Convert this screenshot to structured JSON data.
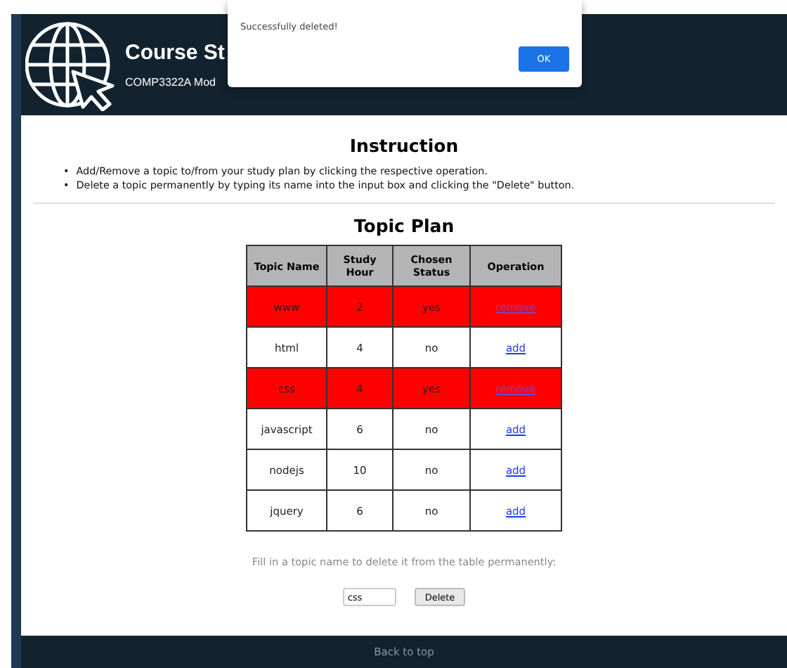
{
  "header": {
    "title": "Course St",
    "subtitle": "COMP3322A Mod"
  },
  "dialog": {
    "message": "Successfully deleted!",
    "button": "OK"
  },
  "instruction": {
    "heading": "Instruction",
    "items": [
      {
        "marker": "•",
        "text": "Add/Remove a topic to/from your study plan by clicking the respective operation."
      },
      {
        "marker": "•",
        "text": "Delete a topic permanently by typing its name into the input box and clicking the \"Delete\" button."
      }
    ]
  },
  "topic_plan": {
    "heading": "Topic Plan",
    "columns": [
      "Topic Name",
      "Study Hour",
      "Chosen Status",
      "Operation"
    ],
    "rows": [
      {
        "name": "www",
        "hours": "2",
        "status": "yes",
        "operation": "remove",
        "chosen": true
      },
      {
        "name": "html",
        "hours": "4",
        "status": "no",
        "operation": "add",
        "chosen": false
      },
      {
        "name": "css",
        "hours": "4",
        "status": "yes",
        "operation": "remove",
        "chosen": true
      },
      {
        "name": "javascript",
        "hours": "6",
        "status": "no",
        "operation": "add",
        "chosen": false
      },
      {
        "name": "nodejs",
        "hours": "10",
        "status": "no",
        "operation": "add",
        "chosen": false
      },
      {
        "name": "jquery",
        "hours": "6",
        "status": "no",
        "operation": "add",
        "chosen": false
      }
    ]
  },
  "delete_form": {
    "prompt": "Fill in a topic name to delete it from the table permanently:",
    "value": "css",
    "button": "Delete"
  },
  "footer": {
    "link": "Back to top"
  }
}
